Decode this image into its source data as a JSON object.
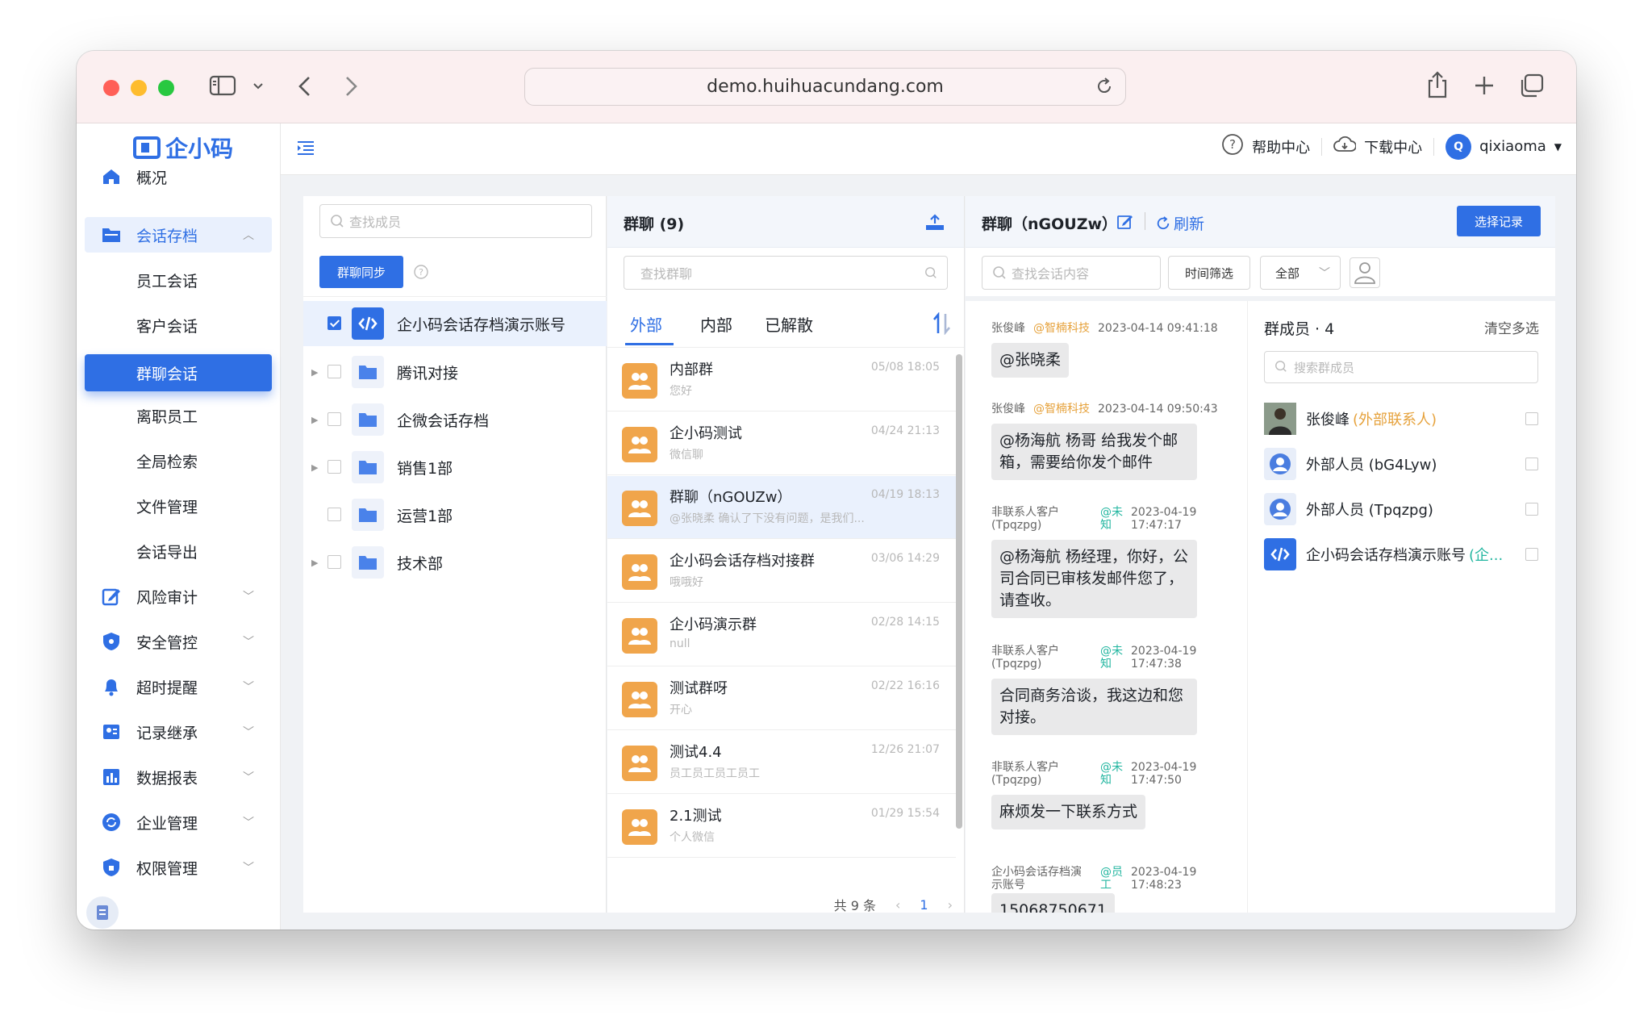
{
  "browser": {
    "url": "demo.huihuacundang.com"
  },
  "app": {
    "logo_text": "企小码"
  },
  "sidebar": {
    "items": [
      {
        "label": "概况",
        "icon": "home-icon"
      },
      {
        "label": "会话存档",
        "icon": "folder-icon"
      },
      {
        "label": "员工会话"
      },
      {
        "label": "客户会话"
      },
      {
        "label": "群聊会话"
      },
      {
        "label": "离职员工"
      },
      {
        "label": "全局检索"
      },
      {
        "label": "文件管理"
      },
      {
        "label": "会话导出"
      },
      {
        "label": "风险审计",
        "icon": "edit-icon"
      },
      {
        "label": "安全管控",
        "icon": "shield-icon"
      },
      {
        "label": "超时提醒",
        "icon": "bell-icon"
      },
      {
        "label": "记录继承",
        "icon": "inherit-icon"
      },
      {
        "label": "数据报表",
        "icon": "bar-chart-icon"
      },
      {
        "label": "企业管理",
        "icon": "sync-icon"
      },
      {
        "label": "权限管理",
        "icon": "lock-icon"
      }
    ]
  },
  "topbar": {
    "help": "帮助中心",
    "download": "下载中心",
    "user": "qixiaoma",
    "avatar_letter": "Q"
  },
  "members_panel": {
    "search_placeholder": "查找成员",
    "sync_button": "群聊同步",
    "tree": [
      {
        "label": "企小码会话存档演示账号",
        "checked": true
      },
      {
        "label": "腾讯对接"
      },
      {
        "label": "企微会话存档"
      },
      {
        "label": "销售1部"
      },
      {
        "label": "运营1部"
      },
      {
        "label": "技术部"
      }
    ]
  },
  "groups_panel": {
    "title": "群聊 (9)",
    "search_placeholder": "查找群聊",
    "tabs": [
      "外部",
      "内部",
      "已解散"
    ],
    "items": [
      {
        "name": "内部群",
        "preview": "您好",
        "time": "05/08 18:05"
      },
      {
        "name": "企小码测试",
        "preview": "微信聊",
        "time": "04/24 21:13"
      },
      {
        "name": "群聊（nGOUZw）",
        "preview": "@张晓柔 确认了下没有问题，是我们...",
        "time": "04/19 18:13"
      },
      {
        "name": "企小码会话存档对接群",
        "preview": "哦哦好",
        "time": "03/06 14:29"
      },
      {
        "name": "企小码演示群",
        "preview": "null",
        "time": "02/28 14:15"
      },
      {
        "name": "测试群呀",
        "preview": "开心",
        "time": "02/22 16:16"
      },
      {
        "name": "测试4.4",
        "preview": "员工员工员工员工",
        "time": "12/26 21:07"
      },
      {
        "name": "2.1测试",
        "preview": "个人微信",
        "time": "01/29 15:54"
      }
    ],
    "pager": {
      "total": "共 9 条",
      "page": "1"
    }
  },
  "chat_panel": {
    "title": "群聊（nGOUZw）",
    "refresh": "刷新",
    "select_button": "选择记录",
    "search_placeholder": "查找会话内容",
    "time_filter": "时间筛选",
    "type_filter": "全部",
    "messages": [
      {
        "sender": "张俊峰",
        "org": "@智楠科技",
        "time": "2023-04-14 09:41:18",
        "text": "@张晓柔"
      },
      {
        "sender": "张俊峰",
        "org": "@智楠科技",
        "time": "2023-04-14 09:50:43",
        "text": "@杨海航 杨哥 给我发个邮箱，需要给你发个邮件"
      },
      {
        "sender": "非联系人客户(Tpqzpg)",
        "role": "@未知",
        "date": "2023-04-19",
        "clock": "17:47:17",
        "text": "@杨海航 杨经理，你好，公司合同已审核发邮件您了，请查收。"
      },
      {
        "sender": "非联系人客户(Tpqzpg)",
        "role": "@未知",
        "date": "2023-04-19",
        "clock": "17:47:38",
        "text": "合同商务洽谈，我这边和您对接。"
      },
      {
        "sender": "非联系人客户(Tpqzpg)",
        "role": "@未知",
        "date": "2023-04-19",
        "clock": "17:47:50",
        "text": "麻烦发一下联系方式"
      },
      {
        "sender": "企小码会话存档演示账号",
        "role": "@员工",
        "date": "2023-04-19",
        "clock": "17:48:23",
        "text": "15068750671"
      }
    ],
    "members": {
      "title": "群成员 · 4",
      "clear": "清空多选",
      "search_placeholder": "搜索群成员",
      "list": [
        {
          "name": "张俊峰",
          "tag": "(外部联系人)"
        },
        {
          "name": "外部人员 (bG4Lyw)"
        },
        {
          "name": "外部人员 (Tpqzpg)"
        },
        {
          "name": "企小码会话存档演示账号",
          "tag": "(企..."
        }
      ]
    }
  },
  "colors": {
    "primary": "#2f6fe4",
    "external_tag": "#e6a23c",
    "role_tag": "#23b6a0"
  }
}
